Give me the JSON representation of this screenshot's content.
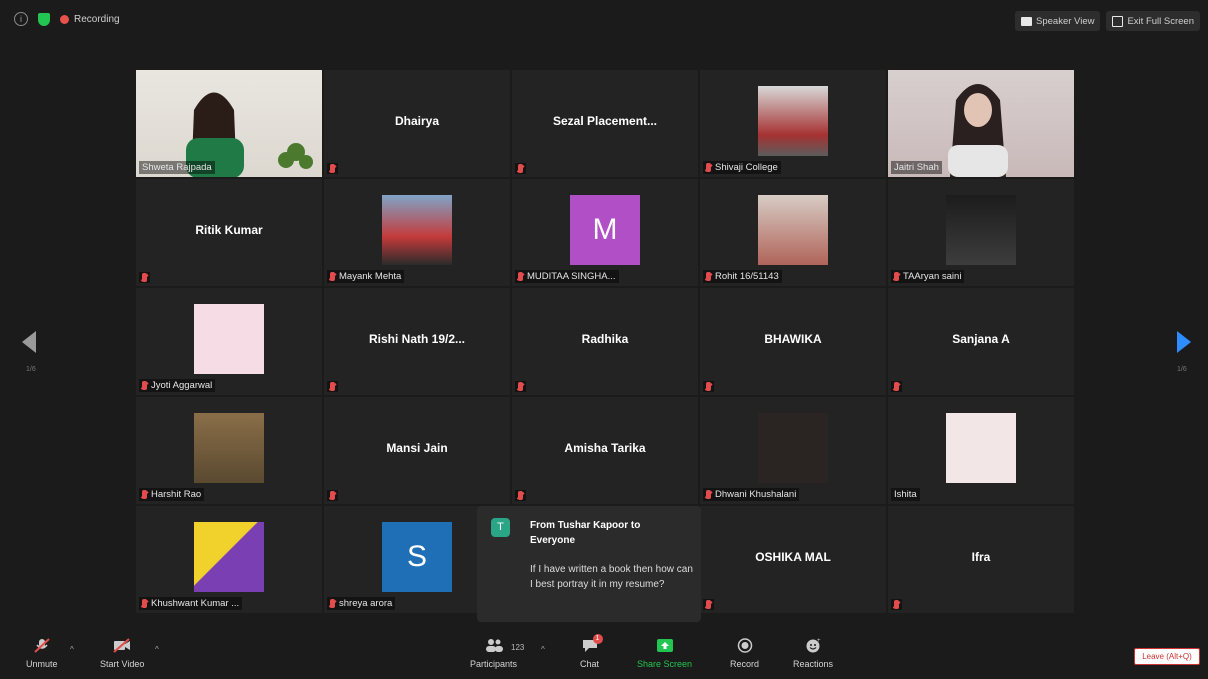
{
  "topbar": {
    "recording_label": "Recording",
    "speaker_view_label": "Speaker View",
    "exit_fullscreen_label": "Exit Full Screen"
  },
  "pagination": {
    "left": "1/6",
    "right": "1/6"
  },
  "tiles": [
    {
      "name": "Shweta Rajpada",
      "kind": "video",
      "active": true
    },
    {
      "name": "Dhairya",
      "kind": "name"
    },
    {
      "name": "Sezal  Placement...",
      "kind": "name"
    },
    {
      "name": "Shivaji College",
      "kind": "pic"
    },
    {
      "name": "Jaitri Shah",
      "kind": "video"
    },
    {
      "name": "Ritik Kumar",
      "kind": "name"
    },
    {
      "name": "Mayank Mehta",
      "kind": "pic"
    },
    {
      "name": "MUDITAA SINGHA...",
      "kind": "letter",
      "letter": "M",
      "color": "#b04fc6"
    },
    {
      "name": "Rohit 16/51143",
      "kind": "pic"
    },
    {
      "name": "TAAryan saini",
      "kind": "pic"
    },
    {
      "name": "Jyoti Aggarwal",
      "kind": "pic"
    },
    {
      "name": "Rishi Nath 19/2...",
      "kind": "name"
    },
    {
      "name": "Radhika",
      "kind": "name"
    },
    {
      "name": "BHAWIKA",
      "kind": "name"
    },
    {
      "name": "Sanjana A",
      "kind": "name"
    },
    {
      "name": "Harshit Rao",
      "kind": "pic"
    },
    {
      "name": "Mansi Jain",
      "kind": "name"
    },
    {
      "name": "Amisha Tarika",
      "kind": "name"
    },
    {
      "name": "Dhwani Khushalani",
      "kind": "pic"
    },
    {
      "name": "Ishita",
      "kind": "pic"
    },
    {
      "name": "Khushwant Kumar ...",
      "kind": "pic"
    },
    {
      "name": "shreya arora",
      "kind": "letter",
      "letter": "S",
      "color": "#1f6fb6"
    },
    {
      "name": "",
      "kind": "hidden"
    },
    {
      "name": "OSHIKA MAL",
      "kind": "name"
    },
    {
      "name": "Ifra",
      "kind": "name"
    }
  ],
  "chat": {
    "avatar_letter": "T",
    "from": "From Tushar Kapoor to Everyone",
    "message": "If I have written a book then how can I best portray it in my resume?"
  },
  "controls": {
    "unmute": "Unmute",
    "start_video": "Start Video",
    "participants": "Participants",
    "participants_count": "123",
    "chat": "Chat",
    "chat_badge": "1",
    "share_screen": "Share Screen",
    "record": "Record",
    "reactions": "Reactions",
    "leave": "Leave (Alt+Q)"
  },
  "colors": {
    "active_border": "#b8e631",
    "share_green": "#23c552",
    "next_arrow": "#2d8cff",
    "muted_red": "#e34c4c"
  }
}
